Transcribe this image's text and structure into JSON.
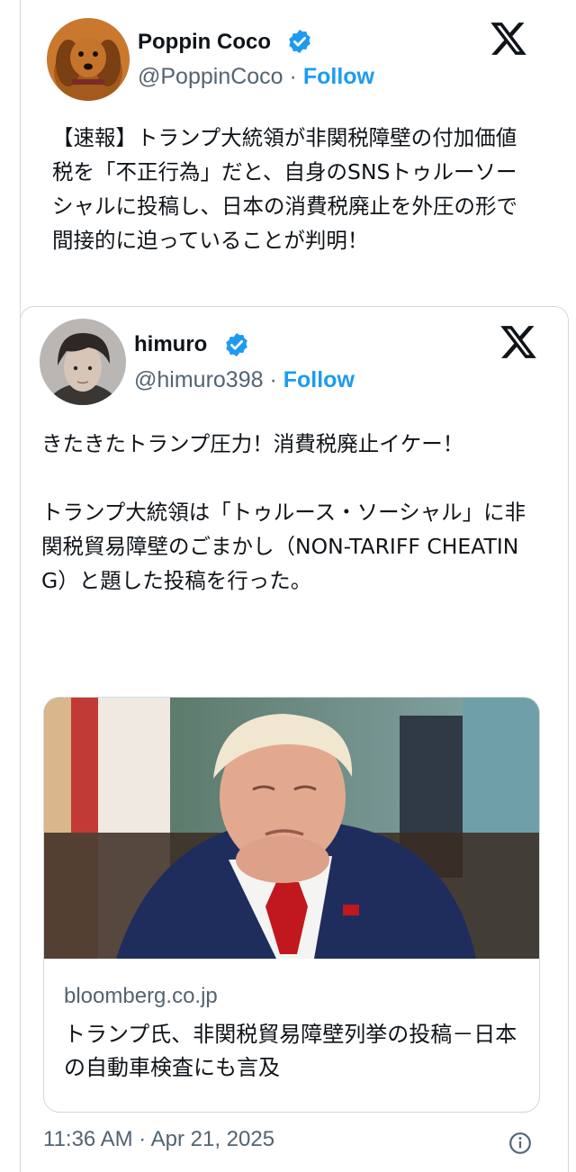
{
  "outer_tweet": {
    "display_name": "Poppin Coco",
    "handle": "@PoppinCoco",
    "separator": "·",
    "follow_label": "Follow",
    "text": "【速報】トランプ大統領が非関税障壁の付加価値税を「不正行為」だと、自身のSNSトゥルーソーシャルに投稿し、日本の消費税廃止を外圧の形で間接的に迫っていることが判明！",
    "avatar_icon": "dog-avatar",
    "logo_icon": "x-logo-icon"
  },
  "quoted_tweet": {
    "display_name": "himuro",
    "handle": "@himuro398",
    "separator": "·",
    "follow_label": "Follow",
    "text": "きたきたトランプ圧力！消費税廃止イケー！\n\nトランプ大統領は「トゥルース・ソーシャル」に非関税貿易障壁のごまかし（NON-TARIFF CHEATING）と題した投稿を行った。",
    "avatar_icon": "person-avatar",
    "logo_icon": "x-logo-icon",
    "link_card": {
      "domain": "bloomberg.co.jp",
      "title": "トランプ氏、非関税貿易障壁列挙の投稿－日本の自動車検査にも言及"
    },
    "timestamp": "11:36 AM · Apr 21, 2025"
  },
  "colors": {
    "accent": "#1d9bf0",
    "secondary_text": "#536471",
    "border": "#cfd9de"
  }
}
